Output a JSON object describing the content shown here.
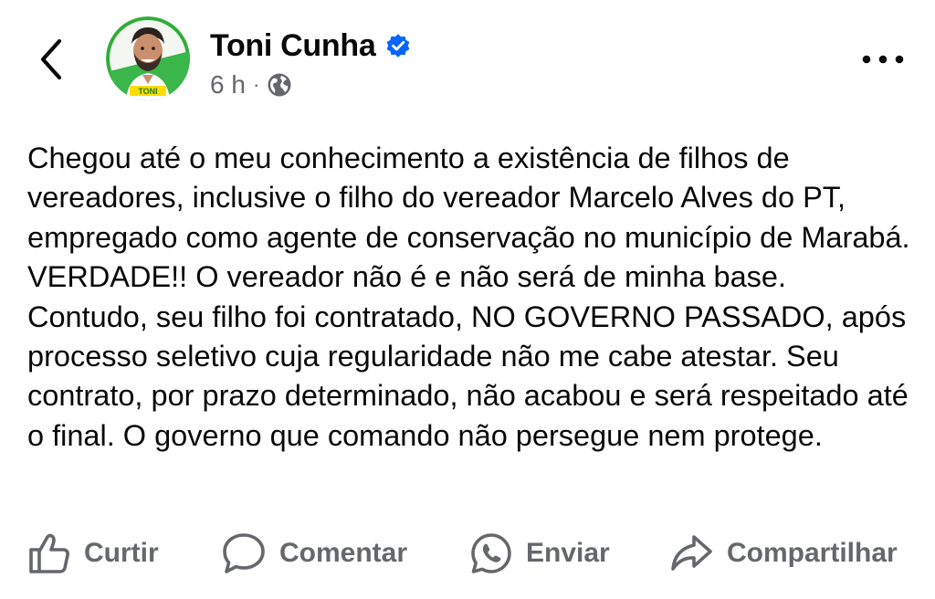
{
  "post": {
    "author": "Toni Cunha",
    "time": "6 h",
    "separator": "·",
    "text": "Chegou até o meu conhecimento a existência de filhos de vereadores, inclusive o filho do vereador Marcelo Alves do PT, empregado como agente de conservação no município de Marabá. VERDADE!! O vereador não é e não será de minha base. Contudo, seu filho foi contratado, NO GOVERNO PASSADO, após processo seletivo cuja regularidade não me cabe atestar. Seu contrato, por prazo determinado, não acabou e será respeitado até o final. O governo que comando não persegue nem protege."
  },
  "avatar_badge": "TONI",
  "actions": {
    "like": "Curtir",
    "comment": "Comentar",
    "send": "Enviar",
    "share": "Compartilhar"
  },
  "icons": {
    "back": "chevron-left-icon",
    "verified": "verified-badge-icon",
    "privacy": "globe-icon",
    "more": "more-horizontal-icon",
    "like": "thumbs-up-icon",
    "comment": "comment-bubble-icon",
    "send": "whatsapp-icon",
    "share": "share-arrow-icon"
  },
  "colors": {
    "text": "#080809",
    "secondary": "#65676b",
    "verified": "#0866ff",
    "avatar_ring": "#2fae3a"
  }
}
